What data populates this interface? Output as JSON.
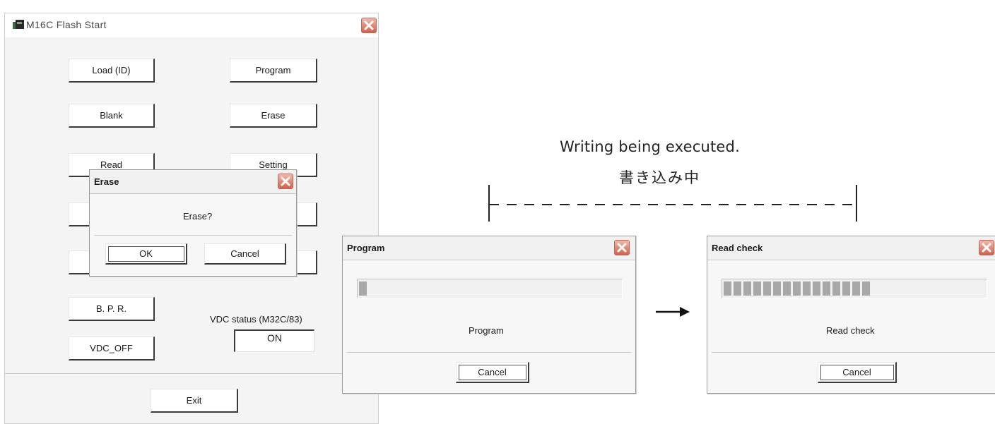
{
  "main_window": {
    "title": "M16C Flash Start",
    "buttons": {
      "load": "Load (ID)",
      "program": "Program",
      "blank": "Blank",
      "erase": "Erase",
      "read": "Read",
      "setting": "Setting",
      "bpr": "B. P. R.",
      "vdc_off": "VDC_OFF",
      "exit": "Exit"
    },
    "vdc_status_label": "VDC status (M32C/83)",
    "vdc_status_value": "ON"
  },
  "erase_dialog": {
    "title": "Erase",
    "message": "Erase?",
    "ok_label": "OK",
    "cancel_label": "Cancel"
  },
  "program_dialog": {
    "title": "Program",
    "status": "Program",
    "cancel_label": "Cancel",
    "progress": 0.04
  },
  "read_check_dialog": {
    "title": "Read check",
    "status": "Read check",
    "cancel_label": "Cancel",
    "progress": 0.58
  },
  "annotation": {
    "english": "Writing being executed.",
    "japanese": "書き込み中"
  },
  "icons": {
    "close": "close-icon",
    "app": "app-icon",
    "arrow": "arrow-right-icon"
  },
  "colors": {
    "close_button": "#d4604a",
    "progress_fill": "#a8a8a8"
  }
}
